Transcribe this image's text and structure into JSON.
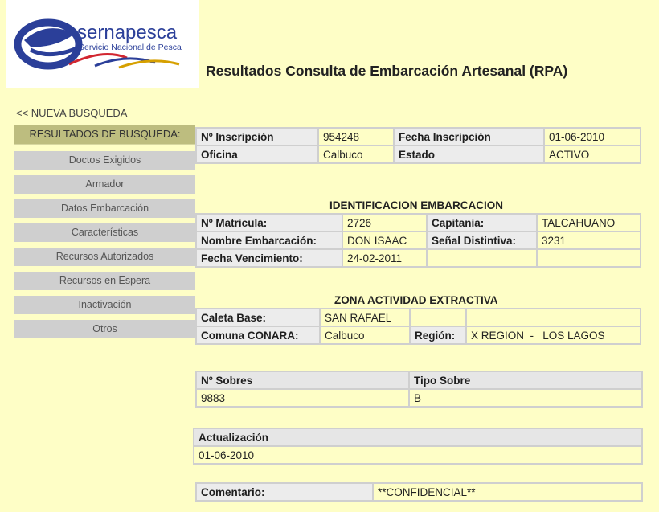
{
  "logo": {
    "brand": "sernapesca",
    "subtitle": "Servicio Nacional de Pesca"
  },
  "page_title": "Resultados Consulta de Embarcación Artesanal (RPA)",
  "new_search": "<<  NUEVA BUSQUEDA",
  "menu": {
    "header": "RESULTADOS DE BUSQUEDA:",
    "items": [
      "Doctos Exigidos",
      "Armador",
      "Datos Embarcación",
      "Características",
      "Recursos Autorizados",
      "Recursos en Espera",
      "Inactivación",
      "Otros"
    ]
  },
  "registro": {
    "inscripcion_label": "Nº Inscripción",
    "inscripcion_value": "954248",
    "fecha_label": "Fecha Inscripción",
    "fecha_value": "01-06-2010",
    "oficina_label": "Oficina",
    "oficina_value": "Calbuco",
    "estado_label": "Estado",
    "estado_value": "ACTIVO"
  },
  "identificacion": {
    "title": "IDENTIFICACION EMBARCACION",
    "matricula_label": "Nº Matricula:",
    "matricula_value": "2726",
    "capitania_label": "Capitania:",
    "capitania_value": "TALCAHUANO",
    "nombre_label": "Nombre Embarcación:",
    "nombre_value": "DON ISAAC",
    "senal_label": "Señal Distintiva:",
    "senal_value": "3231",
    "vencimiento_label": "Fecha Vencimiento:",
    "vencimiento_value": "24-02-2011"
  },
  "zona": {
    "title": "ZONA ACTIVIDAD EXTRACTIVA",
    "caleta_label": "Caleta Base:",
    "caleta_value": "SAN RAFAEL",
    "comuna_label": "Comuna CONARA:",
    "comuna_value": "Calbuco",
    "region_label": "Región:",
    "region_value": "X REGION  -   LOS LAGOS"
  },
  "sobres": {
    "col1": "Nº Sobres",
    "col2": "Tipo Sobre",
    "val1": "9883",
    "val2": "B"
  },
  "actualizacion": {
    "label": "Actualización",
    "value": "01-06-2010"
  },
  "comentario": {
    "label": "Comentario:",
    "value": "**CONFIDENCIAL**"
  },
  "colors": {
    "background": "#fefec6",
    "menu_header": "#bdbd7f",
    "menu_item": "#cfcfcf",
    "logo_blue": "#2b3f99",
    "logo_red": "#d22630"
  }
}
